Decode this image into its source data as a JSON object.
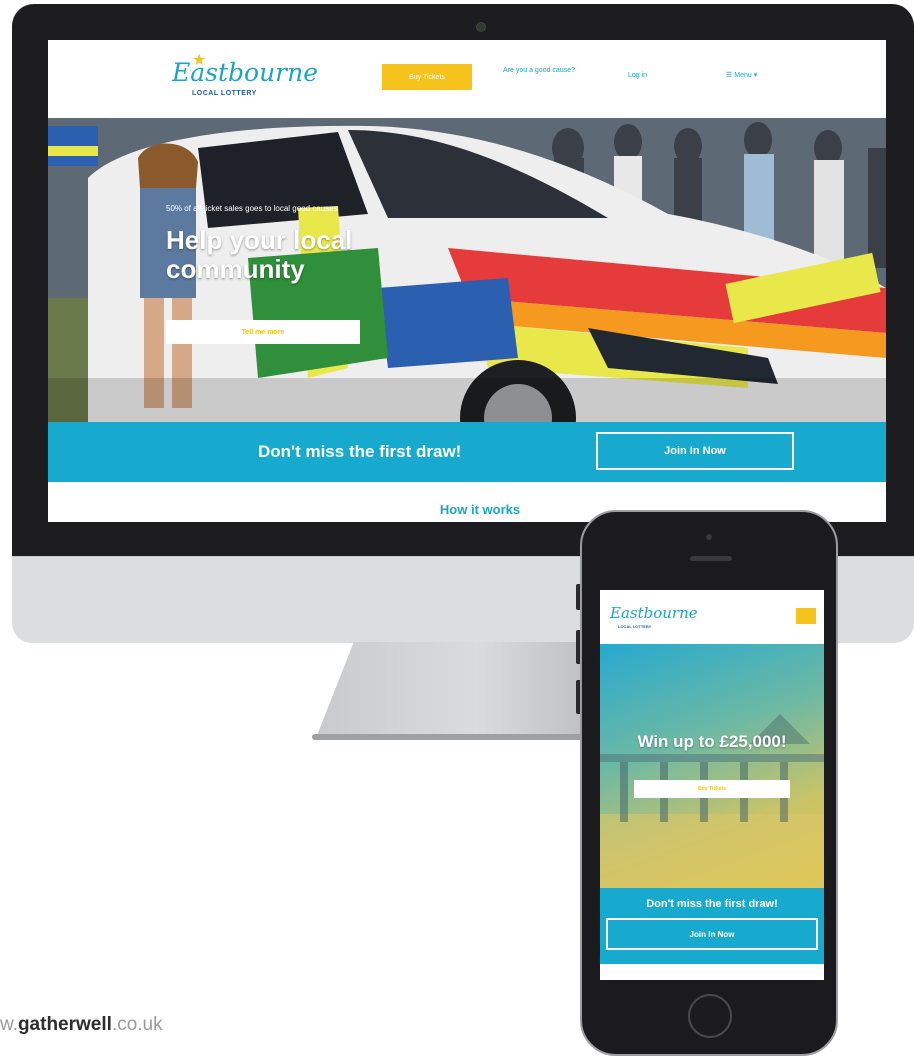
{
  "desktop": {
    "header": {
      "logo_text": "Eastbourne",
      "logo_subtext": "LOCAL LOTTERY",
      "buy_tickets": "Buy Tickets",
      "good_cause": "Are you a good cause?",
      "log_in": "Log in",
      "menu": "Menu"
    },
    "hero": {
      "kicker": "50% of all ticket sales goes to local good causes",
      "title": "Help your local community",
      "cta": "Tell me more"
    },
    "banner": {
      "text": "Don't miss the first draw!",
      "join": "Join In Now"
    },
    "section_title": "How it works"
  },
  "mobile": {
    "logo_text": "Eastbourne",
    "logo_subtext": "LOCAL LOTTERY",
    "hero_title": "Win up to £25,000!",
    "buy_tickets": "Buy Tickets",
    "banner_text": "Don't miss the first draw!",
    "join": "Join In Now"
  },
  "footer": {
    "prefix": "w.",
    "brand": "gatherwell",
    "suffix": ".co.uk"
  },
  "colors": {
    "accent_blue": "#18a9cf",
    "accent_yellow": "#f6c21c"
  },
  "icons": [
    "menu-icon",
    "star-icon",
    "camera-icon",
    "home-button-icon"
  ]
}
